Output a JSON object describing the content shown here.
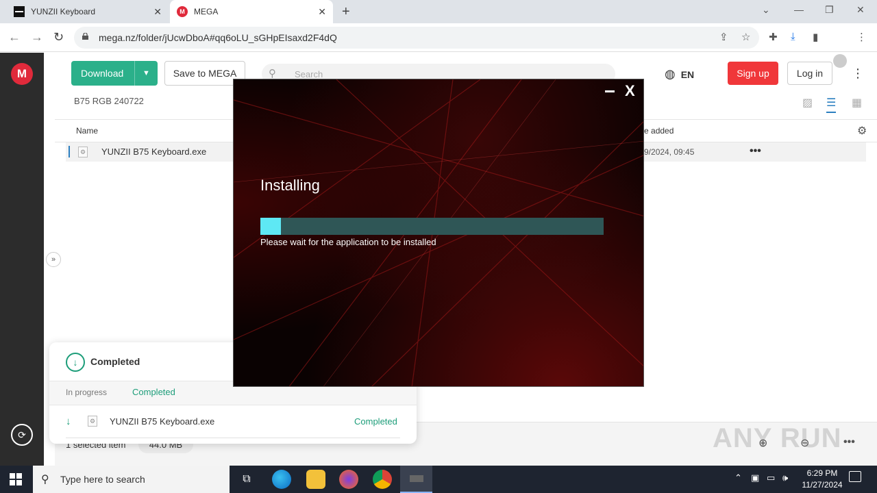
{
  "browser": {
    "tabs": [
      {
        "title": "YUNZII Keyboard",
        "active": false
      },
      {
        "title": "MEGA",
        "active": true
      }
    ],
    "url": "mega.nz/folder/jUcwDboA#qq6oLU_sGHpEIsaxd2F4dQ",
    "accent_color": "#1a73e8"
  },
  "mega": {
    "toolbar": {
      "download_label": "Download",
      "save_label": "Save to MEGA",
      "search_placeholder": "Search",
      "language": "EN",
      "signup_label": "Sign up",
      "login_label": "Log in"
    },
    "folder_name": "B75 RGB 240722",
    "columns": {
      "name": "Name",
      "date_added": "ate added"
    },
    "files": [
      {
        "name": "YUNZII B75 Keyboard.exe",
        "date_added": "/29/2024, 09:45"
      }
    ],
    "status": {
      "selected_text": "1 selected item",
      "selected_size": "44.0 MB",
      "watermark": "ANY RUN"
    },
    "brand_color": "#e02a3b"
  },
  "transfers": {
    "title": "Completed",
    "tab_in_progress": "In progress",
    "tab_completed": "Completed",
    "items": [
      {
        "name": "YUNZII B75 Keyboard.exe",
        "status": "Completed"
      }
    ],
    "accent_color": "#1c9d79"
  },
  "installer": {
    "title": "Installing",
    "message": "Please wait for the application to be installed",
    "progress": 0.06,
    "close_label": "X",
    "fill_color": "#5ee8f4",
    "track_color": "#2f5656"
  },
  "taskbar": {
    "search_placeholder": "Type here to search",
    "time": "6:29 PM",
    "date": "11/27/2024"
  }
}
